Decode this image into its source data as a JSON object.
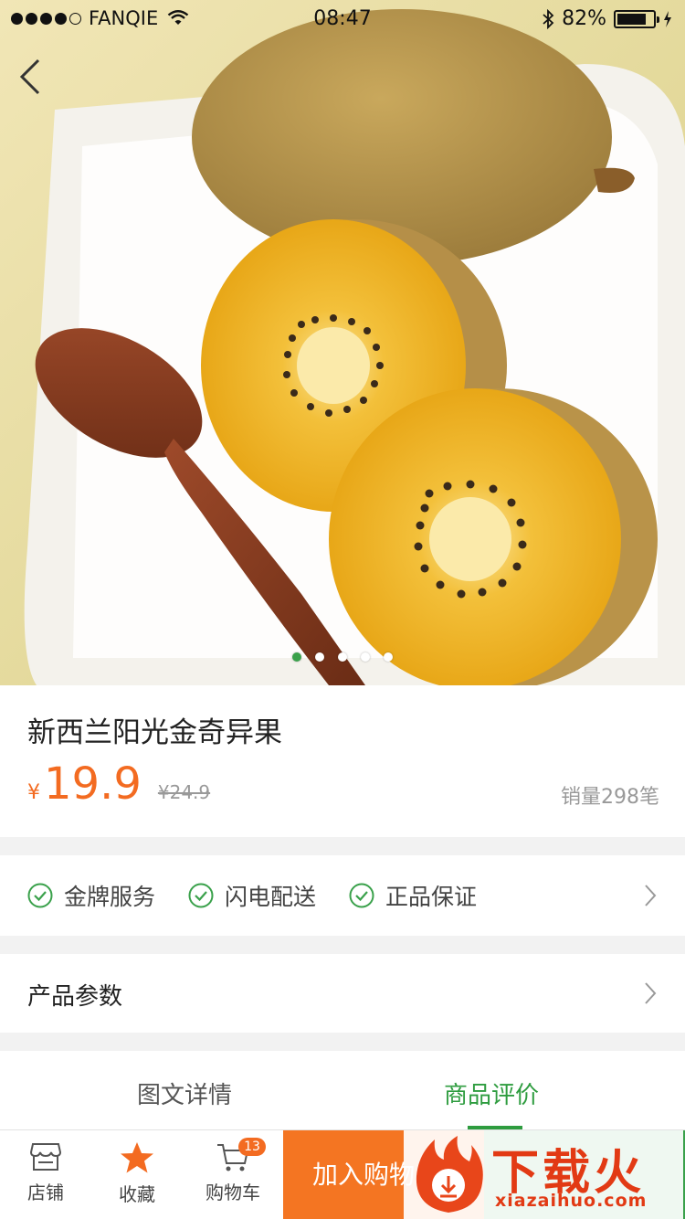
{
  "status_bar": {
    "carrier": "FANQIE",
    "time": "08:47",
    "battery": "82%",
    "battery_level": 0.82
  },
  "gallery": {
    "page_count": 5,
    "active_index": 0
  },
  "product": {
    "title": "新西兰阳光金奇异果",
    "currency": "¥",
    "price": "19.9",
    "original_price": "¥24.9",
    "sales": "销量298笔"
  },
  "services": [
    "金牌服务",
    "闪电配送",
    "正品保证"
  ],
  "params_label": "产品参数",
  "tabs": {
    "details": "图文详情",
    "reviews": "商品评价"
  },
  "bottom_bar": {
    "shop": "店铺",
    "favorite": "收藏",
    "cart": "购物车",
    "cart_badge": "13",
    "add_to_cart": "加入购物"
  },
  "watermark": {
    "text": "下载火",
    "url": "xiazaihuo.com"
  },
  "colors": {
    "accent_orange": "#f36b21",
    "accent_green": "#3aa14b"
  }
}
